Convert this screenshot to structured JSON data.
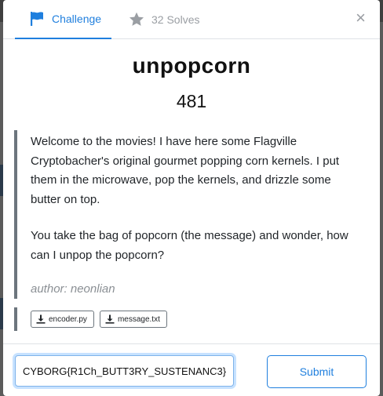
{
  "tabs": {
    "challenge_label": "Challenge",
    "solves_label": "32 Solves"
  },
  "close_label": "×",
  "challenge": {
    "name": "unpopcorn",
    "points": "481",
    "description_p1": "Welcome to the movies! I have here some Flagville Cryptobacher's original gourmet popping corn kernels. I put them in the microwave, pop the kernels, and drizzle some butter on top.",
    "description_p2": "You take the bag of popcorn (the message) and wonder, how can I unpop the popcorn?",
    "author": "author: neonlian",
    "files": [
      "encoder.py",
      "message.txt"
    ]
  },
  "form": {
    "flag_value": "CYBORG{R1Ch_BUTT3RY_SUSTENANC3}",
    "submit_label": "Submit"
  },
  "colors": {
    "accent": "#1f7fde",
    "muted": "#9a9ea3",
    "border_dark": "#6c757d"
  },
  "icons": {
    "challenge_tab": "flag-icon",
    "solves_tab": "star-icon",
    "file": "download-icon",
    "close": "close-icon"
  }
}
